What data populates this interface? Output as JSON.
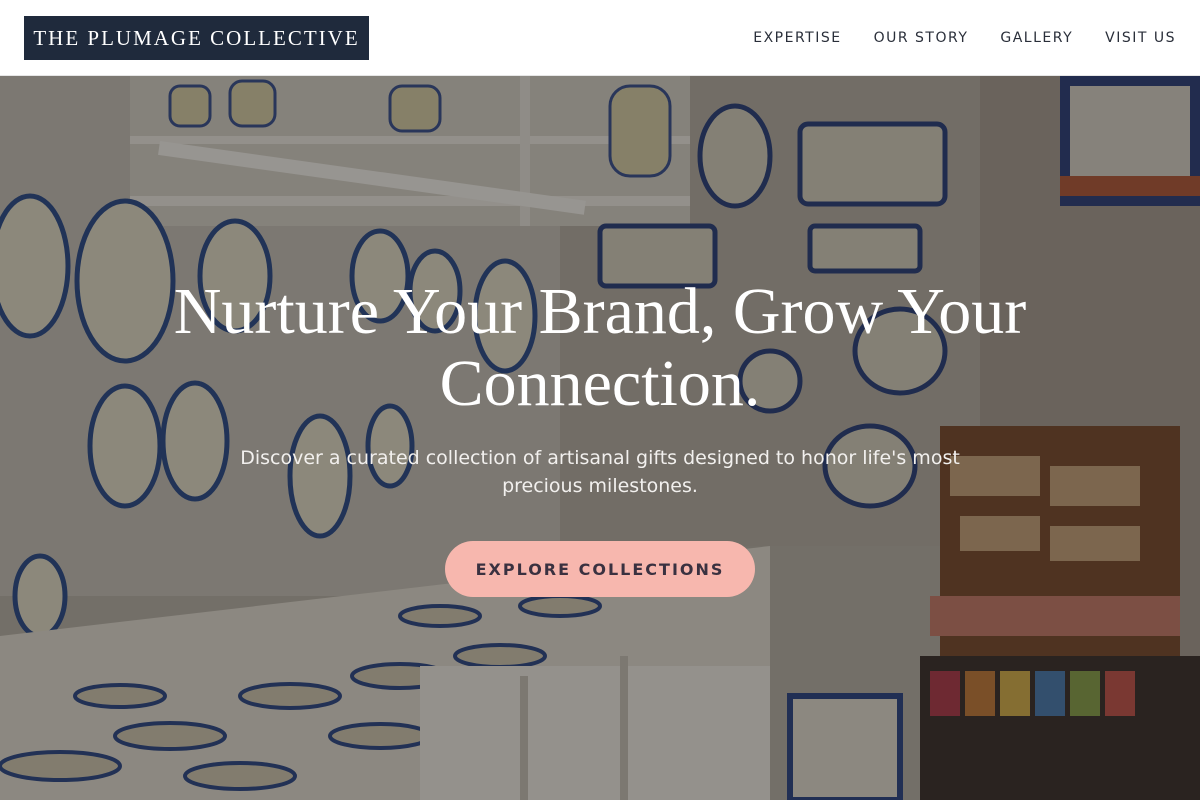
{
  "brand": {
    "logo_text": "THE PLUMAGE COLLECTIVE"
  },
  "nav": {
    "items": [
      {
        "label": "EXPERTISE"
      },
      {
        "label": "OUR STORY"
      },
      {
        "label": "GALLERY"
      },
      {
        "label": "VISIT US"
      }
    ]
  },
  "hero": {
    "headline": "Nurture Your Brand, Grow Your Connection.",
    "subtext": "Discover a curated collection of artisanal gifts designed to honor life's most precious milestones.",
    "cta_label": "EXPLORE COLLECTIONS",
    "background_description_icon": "ceramics-shop-photo"
  },
  "colors": {
    "logo_bg": "#1f2a3c",
    "cta_bg": "#f7b7ae",
    "nav_text": "#2a2f3a"
  }
}
